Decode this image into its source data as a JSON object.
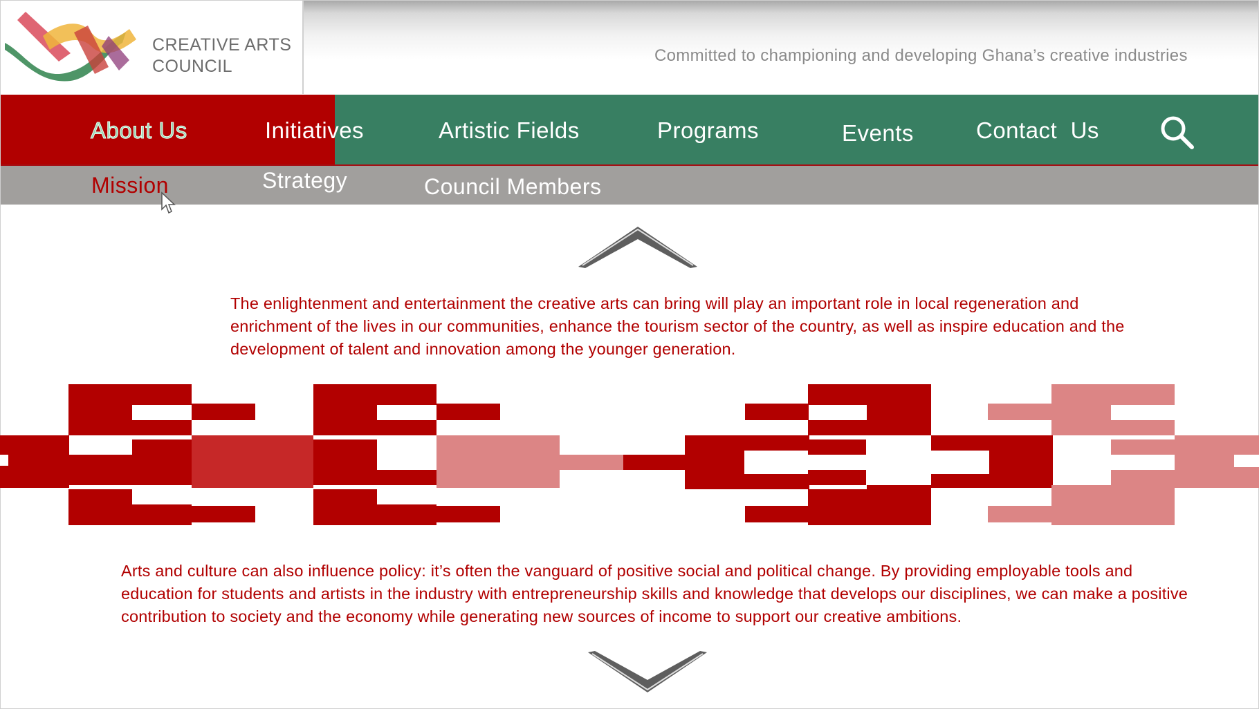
{
  "header": {
    "logo_line1": "CREATIVE ARTS",
    "logo_line2": "COUNCIL",
    "tagline": "Committed to championing and developing Ghana’s creative industries"
  },
  "nav": {
    "items": [
      {
        "label": "About Us"
      },
      {
        "label": "Initiatives"
      },
      {
        "label": "Artistic Fields"
      },
      {
        "label": "Programs"
      },
      {
        "label": "Events"
      },
      {
        "label": "Contact  Us"
      }
    ],
    "active": "About Us",
    "search_icon": "search-icon"
  },
  "subnav": {
    "items": [
      {
        "label": "Mission"
      },
      {
        "label": "Strategy"
      },
      {
        "label": "Council Members"
      }
    ],
    "active": "Mission"
  },
  "content": {
    "paragraph1": "The enlightenment and entertainment the creative arts can bring will play an important role in local regeneration and enrichment of the lives in our communities, enhance the tourism sector of the country, as well as inspire education and the development of talent and innovation among the younger generation.",
    "paragraph2": "Arts and culture can also influence policy: it’s often the vanguard of positive social and political change. By providing employable tools and education for students and artists in the industry with entrepreneurship skills and knowledge that develops our disciplines, we can make a positive contribution to society and the economy while generating new sources of income to support our creative ambitions."
  },
  "colors": {
    "brand_red": "#b10000",
    "brand_green": "#387f62",
    "light_red": "#dc8585",
    "subnav_grey": "#a19f9d"
  }
}
